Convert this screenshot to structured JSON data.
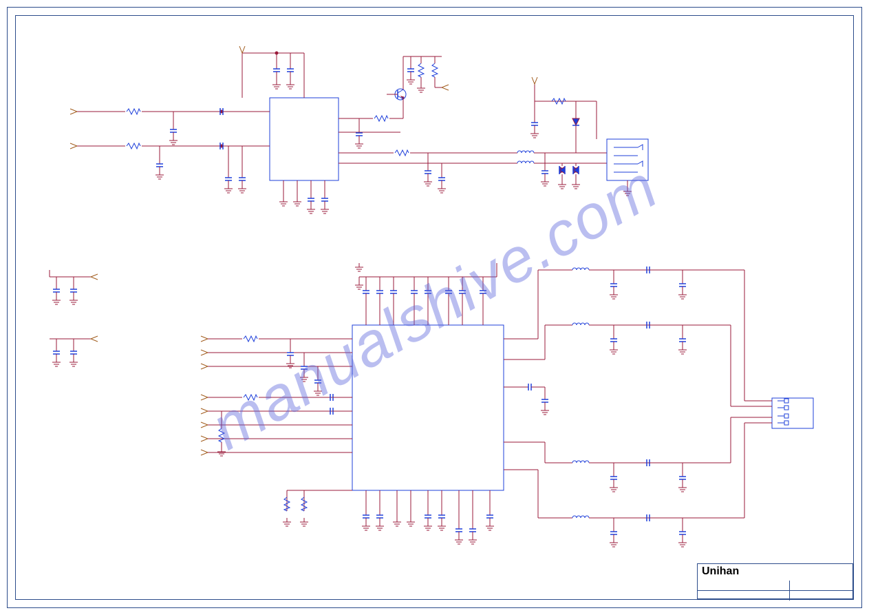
{
  "title_block": {
    "company": "Unihan"
  },
  "watermark": "manualshive.com",
  "colors": {
    "wire": "#9a1a3a",
    "component": "#1e3fda",
    "frame": "#2b4b8a",
    "arrow": "#a05a1a"
  }
}
